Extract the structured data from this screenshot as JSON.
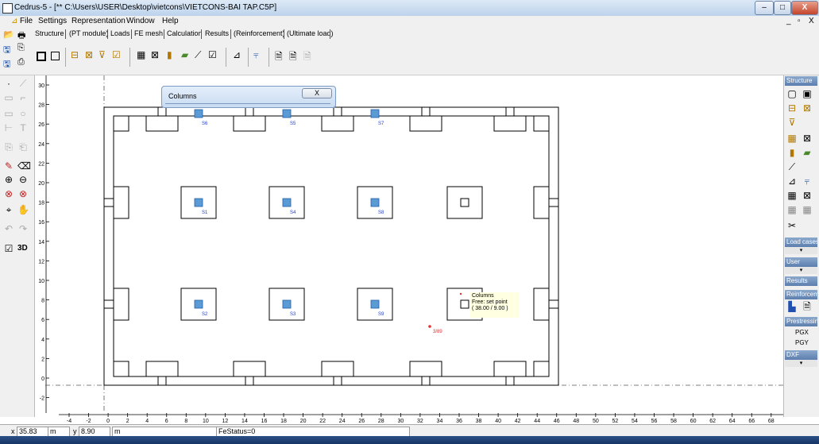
{
  "window": {
    "title": "Cedrus-5 - [** C:\\Users\\USER\\Desktop\\vietcons\\VIETCONS-BAI TAP.C5P]",
    "controls": [
      "–",
      "□",
      "X"
    ]
  },
  "menu": {
    "items": [
      "File",
      "Settings",
      "Representation",
      "Window",
      "Help"
    ],
    "mdi_controls": [
      "_",
      "▫",
      "X"
    ]
  },
  "tabs": [
    "Structure",
    "(PT module)",
    "Loads",
    "FE mesh",
    "Calculation",
    "Results",
    "(Reinforcement)",
    "(Ultimate load)"
  ],
  "dialog": {
    "title": "Columns",
    "close": "X"
  },
  "tooltip": {
    "line1": "Columns",
    "line2": "Free: set point",
    "line3": "( 38.00 / 9.00 )"
  },
  "columns": [
    {
      "label": "S6"
    },
    {
      "label": "S5"
    },
    {
      "label": "S7"
    },
    {
      "label": "S1"
    },
    {
      "label": "S4"
    },
    {
      "label": "S8"
    },
    {
      "label": "S2"
    },
    {
      "label": "S3"
    },
    {
      "label": "S9"
    }
  ],
  "point_label": "3/89",
  "y_axis_ticks": [
    "30",
    "28",
    "26",
    "24",
    "22",
    "20",
    "18",
    "16",
    "14",
    "12",
    "10",
    "8",
    "6",
    "4",
    "2",
    "0",
    "-2"
  ],
  "x_axis_ticks": [
    "-4",
    "-2",
    "0",
    "2",
    "4",
    "6",
    "8",
    "10",
    "12",
    "14",
    "16",
    "18",
    "20",
    "22",
    "24",
    "26",
    "28",
    "30",
    "32",
    "34",
    "36",
    "38",
    "40",
    "42",
    "44",
    "46",
    "48",
    "50",
    "52",
    "54",
    "56",
    "58",
    "60",
    "62",
    "64",
    "66",
    "68"
  ],
  "right_panel": {
    "structure": "Structure",
    "load_cases": "Load cases",
    "user": "User",
    "results": "Results",
    "reinforcement": "Reinforcem",
    "prestressing": "Prestressin",
    "pgx": "PGX",
    "pgy": "PGY",
    "dxf": "DXF"
  },
  "left_panel": {
    "three_d": "3D"
  },
  "status": {
    "x_label": "x",
    "x_value": "35.83",
    "x_unit": "m",
    "y_label": "y",
    "y_value": "8.90",
    "y_unit": "m",
    "fe_status": "FeStatus=0"
  },
  "colors": {
    "column_fill": "#5b9bd5",
    "column_border": "#2060a8",
    "label_blue": "#1f3fd0",
    "point_red": "#e03030"
  }
}
